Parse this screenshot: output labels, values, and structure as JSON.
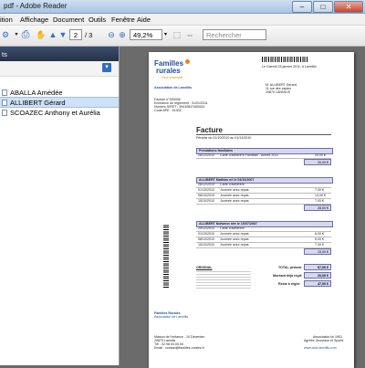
{
  "window": {
    "title": "pdf - Adobe Reader"
  },
  "menu": [
    "ition",
    "Affichage",
    "Document",
    "Outils",
    "Fenêtre",
    "Aide"
  ],
  "toolbar": {
    "page_current": "2",
    "page_total": "/ 3",
    "zoom": "49,2%",
    "search_placeholder": "Rechercher"
  },
  "sidebar": {
    "header_label": "ts",
    "attachments": [
      "ABALLA Amédée",
      "ALLIBERT Gérard",
      "SCOAZEC Anthony et Aurélia"
    ],
    "selected_index": 1
  },
  "document": {
    "logo_line1": "Familles",
    "logo_line2": "rurales",
    "logo_tagline": "Vivre ensemble",
    "association": "Association de Lanvillis",
    "date_line": "Le Gaendi 25 janvier 2011, à Lanvillis",
    "recipient": [
      "M. ALLIBERT Gérard",
      "11 rue des capins",
      "29870 LANNILIS"
    ],
    "ref_lines": [
      "Facture n°000006",
      "Echéance du règlement : 31/01/2011",
      "Numéro SIRET : 39410847400003",
      "Code APE : 9130Z"
    ],
    "title": "Facture",
    "period": "Période du 01/10/2010 au 01/12/2010",
    "section1_title": "Prestations familiales",
    "section1_row": "Carte d'adhérent Familiale - Année 2011",
    "section1_date": "28/12/2010",
    "section1_amount": "20,00 €",
    "section1_total": "20,00 €",
    "section2_title": "ALLIBERT Mathias  né le 04/10/2007",
    "section2_rows": [
      {
        "date": "28/12/2010",
        "label": "Carte d'adhérent",
        "amount": ""
      },
      {
        "date": "01/10/2010",
        "label": "Journée avec repas",
        "amount": "7,00 €"
      },
      {
        "date": "08/10/2010",
        "label": "Journée avec repas",
        "amount": "14,00 €"
      },
      {
        "date": "15/10/2010",
        "label": "Journée avec repas",
        "amount": "7,00 €"
      }
    ],
    "section2_total": "28,00 €",
    "section3_title": "ALLIBERT Nolwenn  née le 10/07/2007",
    "section3_rows": [
      {
        "date": "29/12/2010",
        "label": "Carte d'adhérent",
        "amount": ""
      },
      {
        "date": "01/10/2010",
        "label": "Journée avec repas",
        "amount": "6,00 €"
      },
      {
        "date": "08/10/2010",
        "label": "Journée avec repas",
        "amount": "6,00 €"
      },
      {
        "date": "15/10/2010",
        "label": "Journée avec repas",
        "amount": "7,00 €"
      }
    ],
    "section3_total": "19,00 €",
    "total_label": "TOTAL période",
    "total_value": "67,00 €",
    "paid_label": "Montant déjà réglé",
    "paid_value": "20,00 €",
    "due_label": "Reste à régler",
    "due_value": "47,00 €",
    "original_label": "ORIGINAL",
    "footer_org": "Familles Rurales",
    "footer_assoc": "Association de Lanvillis",
    "footer_right": [
      "Association loi 1901",
      "Agréée Jeunesse et Sports"
    ],
    "footer_left": [
      "Maison de l'enfance - 10 Déventen",
      "29870 Lannilis",
      "Tél : 02.98.04.00.00",
      "Email : contact@familles-rurales.fr"
    ],
    "footer_url": "www.club-lanvillis.com"
  },
  "colors": {
    "accent_blue": "#1f4e9c",
    "logo_orange": "#e8861a",
    "table_fill": "#d6d8ee"
  }
}
